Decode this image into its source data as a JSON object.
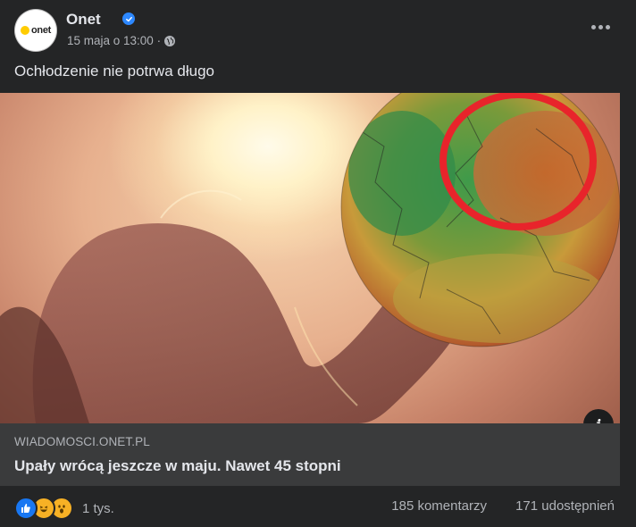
{
  "post": {
    "page_name": "Onet",
    "avatar_text": "onet",
    "timestamp": "15 maja o 13:00 ·",
    "privacy_icon": "globe-icon",
    "caption": "Ochłodzenie nie potrwa długo"
  },
  "link_preview": {
    "domain": "WIADOMOSCI.ONET.PL",
    "title": "Upały wrócą jeszcze w maju. Nawet 45 stopni",
    "info_icon_label": "i"
  },
  "stats": {
    "reaction_icons": [
      "like-icon",
      "haha-icon",
      "wow-icon"
    ],
    "reactions": "1 tys.",
    "comments": "185 komentarzy",
    "shares": "171 udostępnień"
  },
  "colors": {
    "background": "#242526",
    "link_box": "#3a3b3c",
    "verified_badge": "#2d88ff",
    "like": "#1877f2",
    "emoji": "#f7b125",
    "highlight_ring": "#e8242b"
  }
}
